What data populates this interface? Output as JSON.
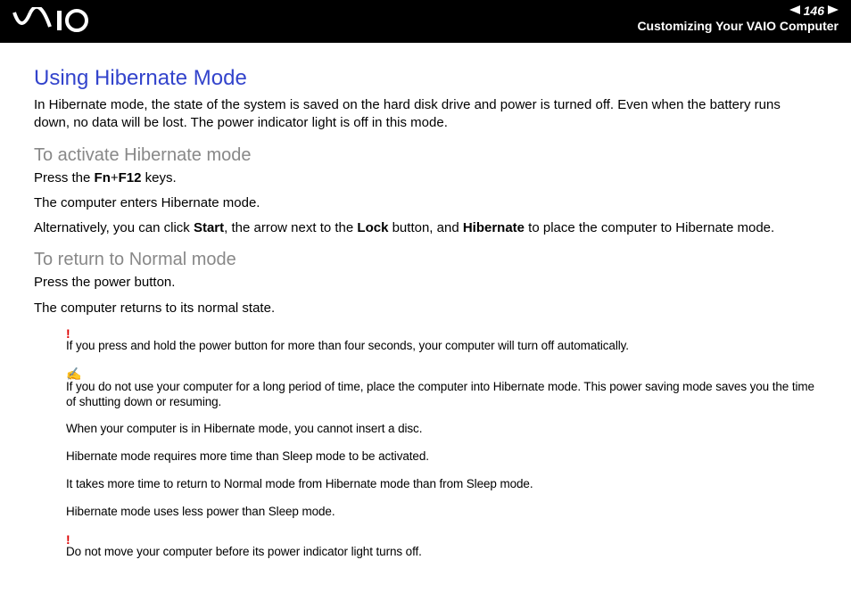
{
  "header": {
    "page_number": "146",
    "section": "Customizing Your VAIO Computer"
  },
  "title": "Using Hibernate Mode",
  "intro": "In Hibernate mode, the state of the system is saved on the hard disk drive and power is turned off. Even when the battery runs down, no data will be lost. The power indicator light is off in this mode.",
  "sub1": {
    "heading": "To activate Hibernate mode",
    "line1_pre": "Press the ",
    "line1_b1": "Fn",
    "line1_mid": "+",
    "line1_b2": "F12",
    "line1_post": " keys.",
    "line2": "The computer enters Hibernate mode.",
    "line3_pre": "Alternatively, you can click ",
    "line3_b1": "Start",
    "line3_mid1": ", the arrow next to the ",
    "line3_b2": "Lock",
    "line3_mid2": " button, and ",
    "line3_b3": "Hibernate",
    "line3_post": " to place the computer to Hibernate mode."
  },
  "sub2": {
    "heading": "To return to Normal mode",
    "line1": "Press the power button.",
    "line2": "The computer returns to its normal state."
  },
  "notes": {
    "warn1": "If you press and hold the power button for more than four seconds, your computer will turn off automatically.",
    "tip1": "If you do not use your computer for a long period of time, place the computer into Hibernate mode. This power saving mode saves you the time of shutting down or resuming.",
    "tip2": "When your computer is in Hibernate mode, you cannot insert a disc.",
    "tip3": "Hibernate mode requires more time than Sleep mode to be activated.",
    "tip4": "It takes more time to return to Normal mode from Hibernate mode than from Sleep mode.",
    "tip5": "Hibernate mode uses less power than Sleep mode.",
    "warn2": "Do not move your computer before its power indicator light turns off."
  }
}
